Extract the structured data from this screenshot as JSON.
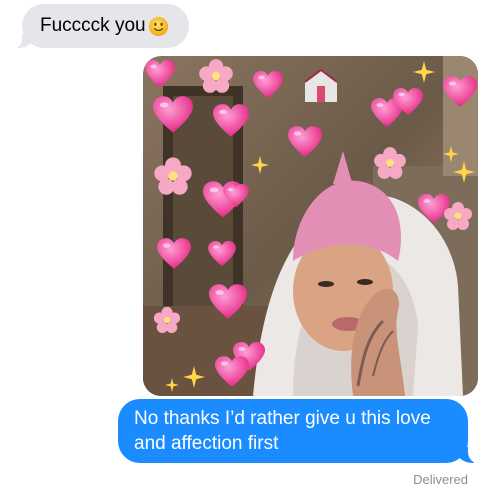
{
  "messages": {
    "received": {
      "text": "Fucccck you",
      "emoji": "slightly-smiling-face"
    },
    "photo": {
      "description_icon": "photo-message"
    },
    "sent": {
      "line1": "No thanks I’d rather give u this love",
      "line2": "and affection first"
    },
    "status": "Delivered"
  },
  "colors": {
    "sent_bubble": "#1a8cff",
    "received_bubble": "#e5e5ea",
    "status_text": "#8e8e93"
  }
}
